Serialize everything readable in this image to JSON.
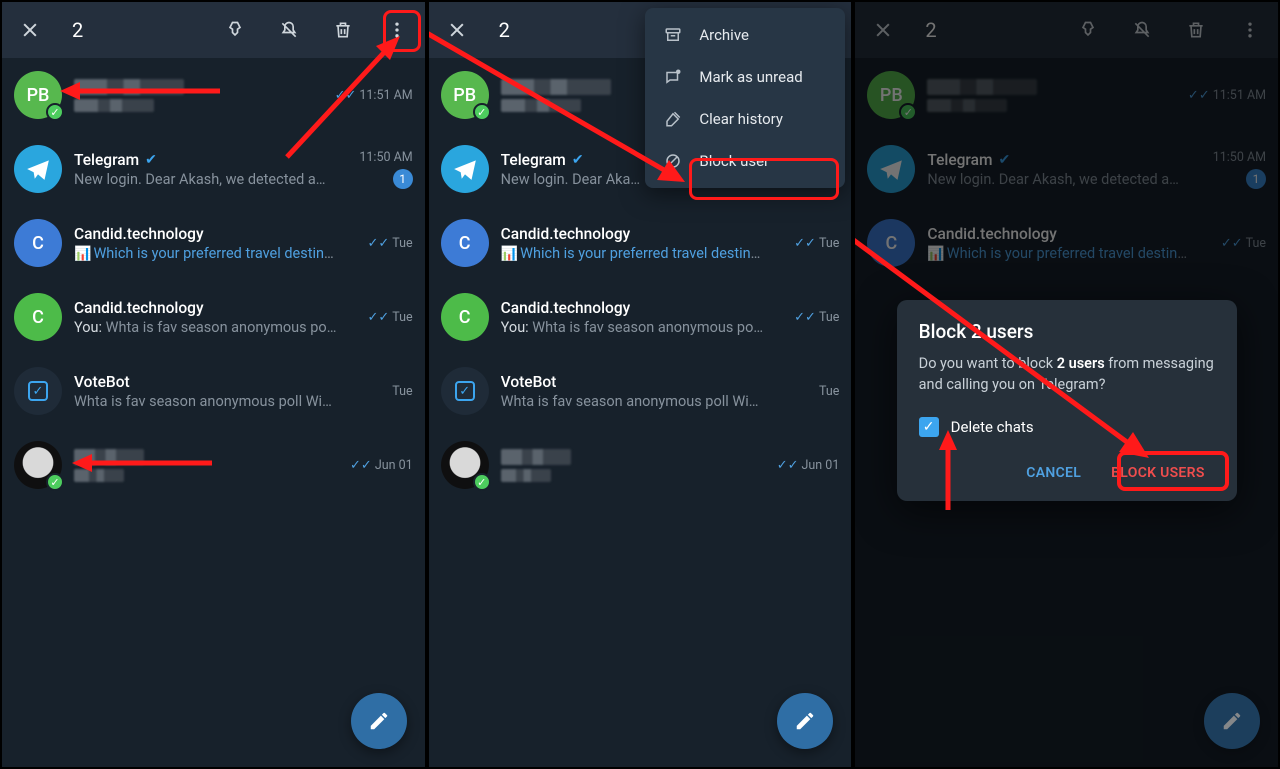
{
  "header": {
    "count": "2"
  },
  "menu": {
    "archive": "Archive",
    "mark_unread": "Mark as unread",
    "clear_history": "Clear history",
    "block_user": "Block user"
  },
  "dialog": {
    "title": "Block 2 users",
    "msg_lead": "Do you want to block ",
    "msg_bold": "2 users",
    "msg_tail": " from messaging and calling you on Telegram?",
    "delete_chats": "Delete chats",
    "cancel": "CANCEL",
    "block": "BLOCK USERS"
  },
  "chats": {
    "pb": {
      "initials": "PB",
      "time": "11:51 AM"
    },
    "telegram": {
      "name": "Telegram",
      "preview": "New login. Dear Akash, we detected a…",
      "preview_short": "New login. Dear Aka…",
      "time": "11:50 AM",
      "unread": "1"
    },
    "ct1": {
      "name": "Candid.technology",
      "link": "Which is your preferred travel destinatio…",
      "time": "Tue"
    },
    "ct2": {
      "name": "Candid.technology",
      "you": "You: ",
      "preview": "Whta is fav season anonymous poll…",
      "time": "Tue"
    },
    "votebot": {
      "name": "VoteBot",
      "preview": "Whta is fav season anonymous poll  Winte…",
      "time": "Tue"
    },
    "bat": {
      "time": "Jun 01"
    }
  },
  "icons": {
    "poll": "📊"
  }
}
